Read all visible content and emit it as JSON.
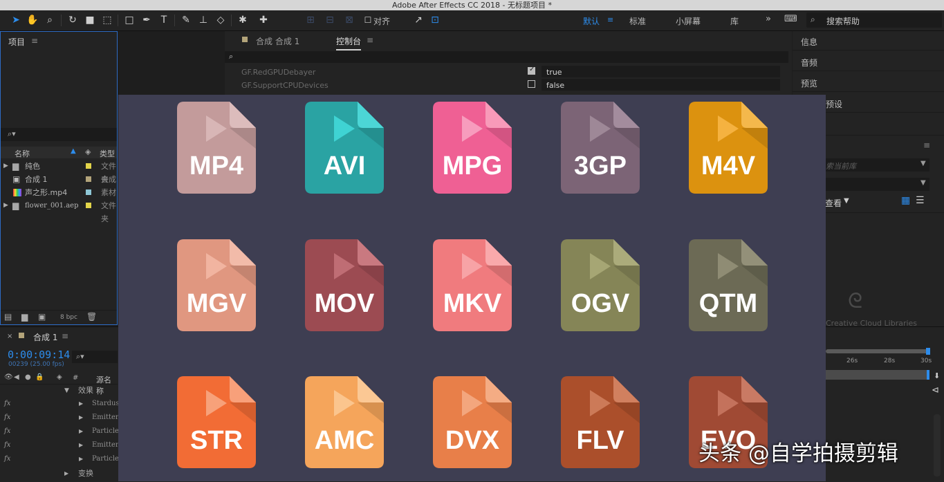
{
  "window": {
    "title": "Adobe After Effects CC 2018 - 无标题项目 *"
  },
  "toolbar": {
    "align_label": "对齐",
    "workspaces": [
      "默认",
      "标准",
      "小屏幕",
      "库"
    ],
    "search_placeholder": "搜索帮助"
  },
  "project": {
    "title": "项目",
    "columns": {
      "name": "名称",
      "type": "类型"
    },
    "items": [
      {
        "name": "纯色",
        "type": "文件夹",
        "color": "#e3d54a"
      },
      {
        "name": "合成 1",
        "type": "合成",
        "color": "#b3a47a"
      },
      {
        "name": "声之形.mp4",
        "type": "素材",
        "color": "#8ec7d6"
      },
      {
        "name": "flower_001.aep",
        "type": "文件夹",
        "color": "#e3d54a"
      }
    ],
    "bpc": "8 bpc"
  },
  "console": {
    "tabs": [
      "合成 合成 1",
      "控制台"
    ],
    "rows": [
      {
        "key": "GF.RedGPUDebayer",
        "checked": true,
        "value": "true"
      },
      {
        "key": "GF.SupportCPUDevices",
        "checked": false,
        "value": "false"
      }
    ]
  },
  "right_panel": {
    "labels": [
      "信息",
      "音频",
      "预览",
      "预设"
    ],
    "library_placeholder": "索当前库",
    "view_label": "查看",
    "cc_libraries": "Creative Cloud Libraries"
  },
  "timeline": {
    "tab": "合成 1",
    "timecode": "0:00:09:14",
    "frame_info": "00239 (25.00 fps)",
    "col_hash": "#",
    "col_source": "源名称",
    "layers": [
      {
        "name": "效果",
        "fx": false,
        "indent": 1
      },
      {
        "name": "Stardust",
        "fx": true,
        "indent": 2
      },
      {
        "name": "Emitter",
        "fx": true,
        "indent": 2
      },
      {
        "name": "Particle",
        "fx": true,
        "indent": 2
      },
      {
        "name": "Emitter",
        "fx": true,
        "indent": 2
      },
      {
        "name": "Particle",
        "fx": true,
        "indent": 2
      },
      {
        "name": "变换",
        "fx": false,
        "indent": 1
      }
    ],
    "ruler": [
      "26s",
      "28s",
      "30s"
    ]
  },
  "overlay": {
    "icons": [
      {
        "ext": "MP4",
        "body": "#c39b9b",
        "fold": "#dcbcbc",
        "play": "#d8b6b6"
      },
      {
        "ext": "AVI",
        "body": "#2aa3a3",
        "fold": "#4cd6d6",
        "play": "#3fd3d3"
      },
      {
        "ext": "MPG",
        "body": "#ef6094",
        "fold": "#f89ab9",
        "play": "#f79cbd"
      },
      {
        "ext": "3GP",
        "body": "#7c6476",
        "fold": "#a38c9d",
        "play": "#9e8897"
      },
      {
        "ext": "M4V",
        "body": "#dc920f",
        "fold": "#f4b84c",
        "play": "#f5b240"
      },
      {
        "ext": "MGV",
        "body": "#e09780",
        "fold": "#f2bba9",
        "play": "#f1b4a0"
      },
      {
        "ext": "MOV",
        "body": "#9c4b52",
        "fold": "#c97980",
        "play": "#bf6d74"
      },
      {
        "ext": "MKV",
        "body": "#f07b7e",
        "fold": "#f9a9ab",
        "play": "#f7a3a6"
      },
      {
        "ext": "OGV",
        "body": "#858557",
        "fold": "#abab7b",
        "play": "#a6a674"
      },
      {
        "ext": "QTM",
        "body": "#6c6a55",
        "fold": "#939079",
        "play": "#8f8c74"
      },
      {
        "ext": "STR",
        "body": "#f26c35",
        "fold": "#f8a07a",
        "play": "#f7a17a"
      },
      {
        "ext": "AMC",
        "body": "#f5a55b",
        "fold": "#fbc894",
        "play": "#fbc58e"
      },
      {
        "ext": "DVX",
        "body": "#e87f49",
        "fold": "#f4ac84",
        "play": "#f3a67d"
      },
      {
        "ext": "FLV",
        "body": "#ab4f2b",
        "fold": "#d1805f",
        "play": "#cc7a58"
      },
      {
        "ext": "EVO",
        "body": "#a04a34",
        "fold": "#c97a64",
        "play": "#c4725c"
      }
    ]
  },
  "watermark": "头条 @自学拍摄剪辑"
}
